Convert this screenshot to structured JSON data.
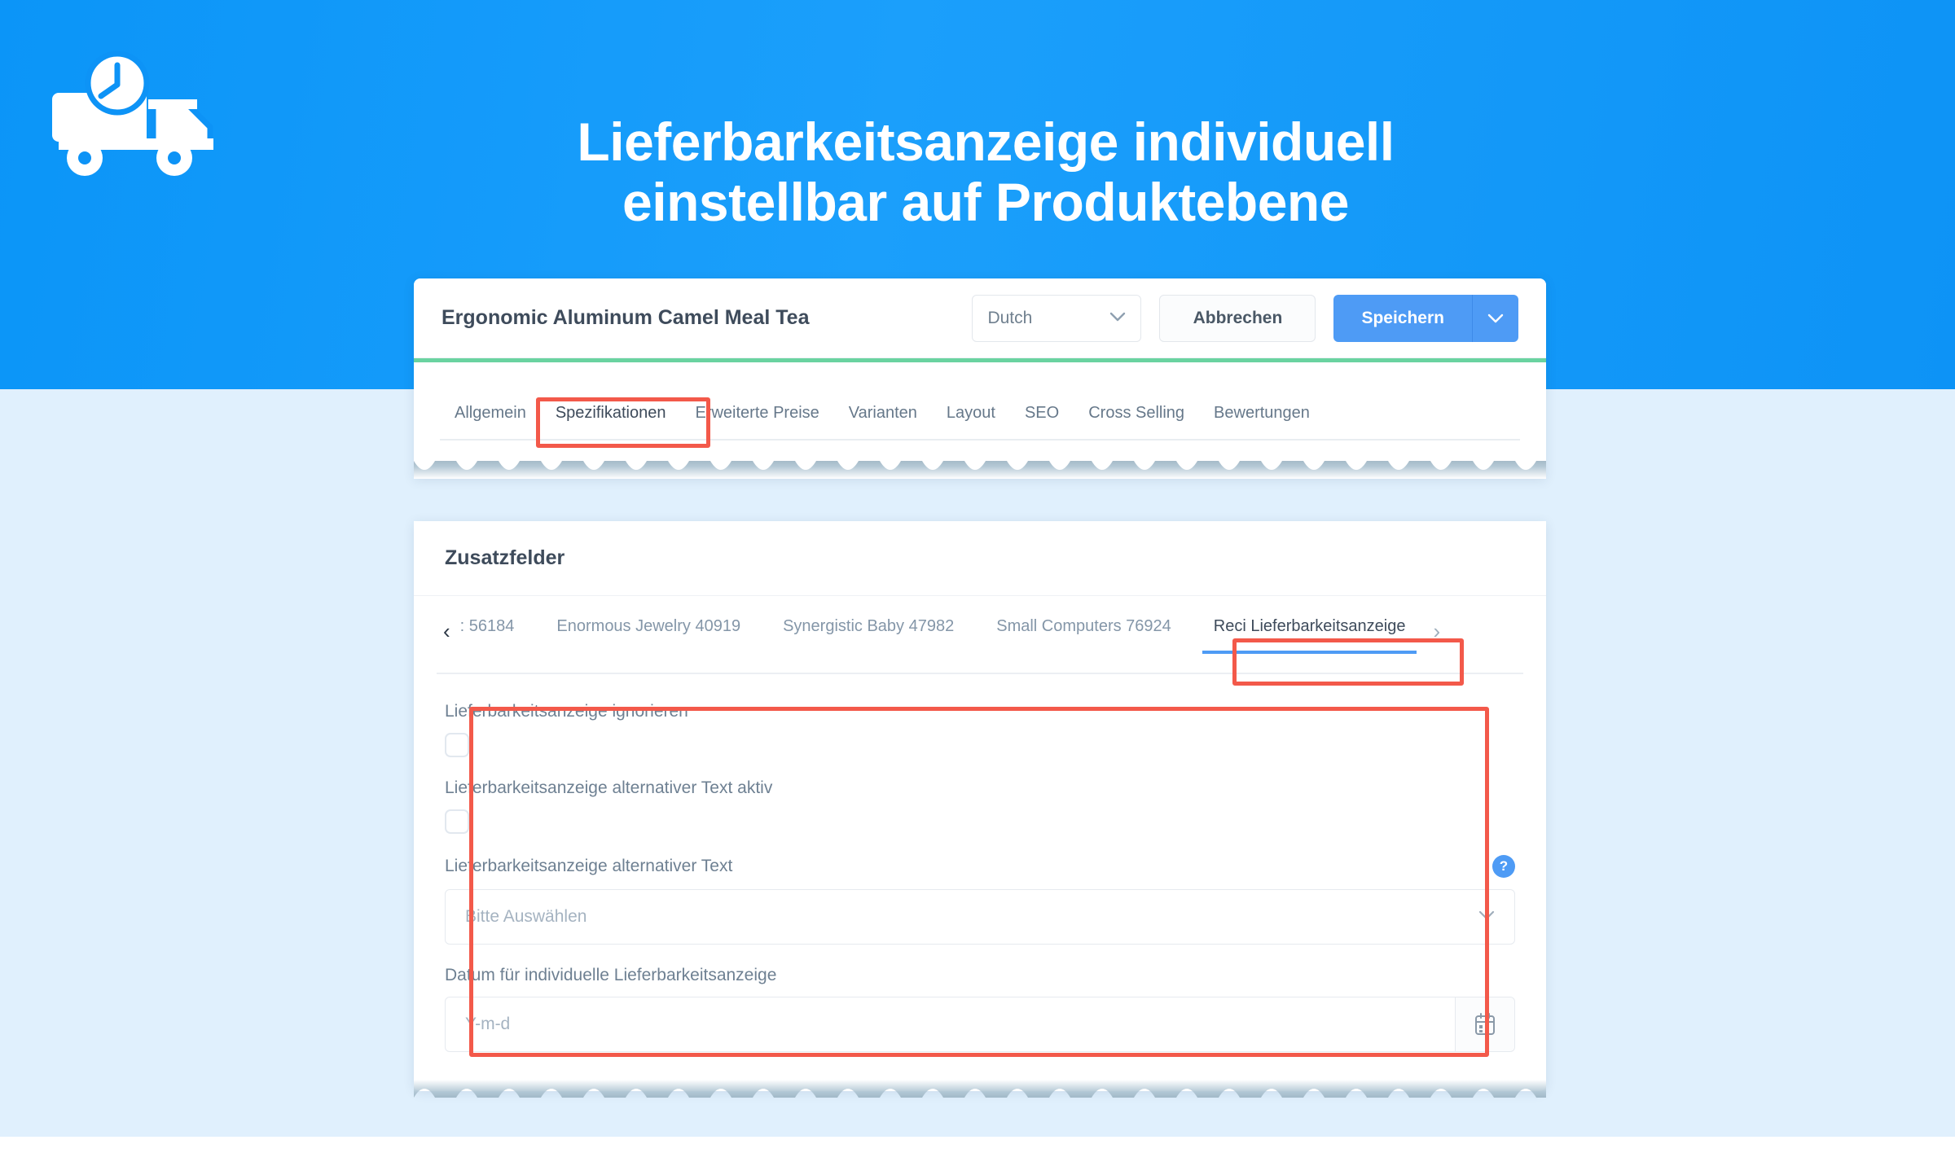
{
  "hero": {
    "title": "Lieferbarkeitsanzeige individuell\neinstellbar auf Produktebene",
    "icon_name": "delivery-truck-clock-icon",
    "background_color": "#0d93f6",
    "text_color": "#ffffff"
  },
  "page": {
    "background_color": "#e0f0fd",
    "accent_color": "#4e9bf5",
    "highlight_color": "#f3594a",
    "success_bar_color": "#6ad3a0"
  },
  "app_header": {
    "product_title": "Ergonomic Aluminum Camel Meal Tea",
    "language_select": {
      "value": "Dutch",
      "caret_icon": "chevron-down-icon"
    },
    "cancel_label": "Abbrechen",
    "save_label": "Speichern",
    "save_caret_icon": "chevron-down-icon"
  },
  "tabs": [
    {
      "label": "Allgemein",
      "active": false
    },
    {
      "label": "Spezifikationen",
      "active": true
    },
    {
      "label": "Erweiterte Preise",
      "active": false
    },
    {
      "label": "Varianten",
      "active": false
    },
    {
      "label": "Layout",
      "active": false
    },
    {
      "label": "SEO",
      "active": false
    },
    {
      "label": "Cross Selling",
      "active": false
    },
    {
      "label": "Bewertungen",
      "active": false
    }
  ],
  "section": {
    "title": "Zusatzfelder"
  },
  "subtabs": {
    "prev_icon": "chevron-left-icon",
    "next_icon": "chevron-right-icon",
    "items": [
      {
        "label": ": 56184",
        "active": false
      },
      {
        "label": "Enormous Jewelry 40919",
        "active": false
      },
      {
        "label": "Synergistic Baby 47982",
        "active": false
      },
      {
        "label": "Small Computers 76924",
        "active": false
      },
      {
        "label": "Reci Lieferbarkeitsanzeige",
        "active": true
      }
    ]
  },
  "form": {
    "ignore_field": {
      "label": "Lieferbarkeitsanzeige ignorieren",
      "checked": false
    },
    "alt_text_active_field": {
      "label": "Lieferbarkeitsanzeige alternativer Text aktiv",
      "checked": false
    },
    "alt_text_field": {
      "label": "Lieferbarkeitsanzeige alternativer Text",
      "placeholder": "Bitte Auswählen",
      "help_icon": "question-mark-icon",
      "caret_icon": "chevron-down-icon"
    },
    "date_field": {
      "label": "Datum für individuelle Lieferbarkeitsanzeige",
      "placeholder": "Y-m-d",
      "calendar_icon": "calendar-icon"
    }
  }
}
